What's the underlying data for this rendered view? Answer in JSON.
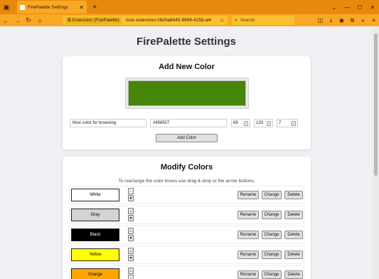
{
  "browser": {
    "tab_title": "FirePalette Settings",
    "url_badge": "Extension (FirePalette)",
    "url": "moz-extension://8d3a8445-9998-4258-a409-...",
    "search_placeholder": "Search"
  },
  "page": {
    "title": "FirePalette Settings"
  },
  "add_color": {
    "heading": "Add New Color",
    "preview_color": "#458507",
    "name_value": "Nice color for browsing",
    "hex_value": "#458507",
    "r": "69",
    "g": "133",
    "b": "7",
    "add_button": "Add Color"
  },
  "modify": {
    "heading": "Modify Colors",
    "hint": "To rearrange the color boxes use drag & drop or the arrow buttons.",
    "rename_label": "Rename",
    "change_label": "Change",
    "delete_label": "Delete",
    "colors": [
      {
        "name": "White",
        "bg": "#ffffff",
        "fg": "#000000"
      },
      {
        "name": "Gray",
        "bg": "#d3d3d3",
        "fg": "#000000"
      },
      {
        "name": "Black",
        "bg": "#000000",
        "fg": "#ffffff"
      },
      {
        "name": "Yellow",
        "bg": "#ffff00",
        "fg": "#000000"
      },
      {
        "name": "Orange",
        "bg": "#ffa500",
        "fg": "#000000"
      }
    ]
  }
}
